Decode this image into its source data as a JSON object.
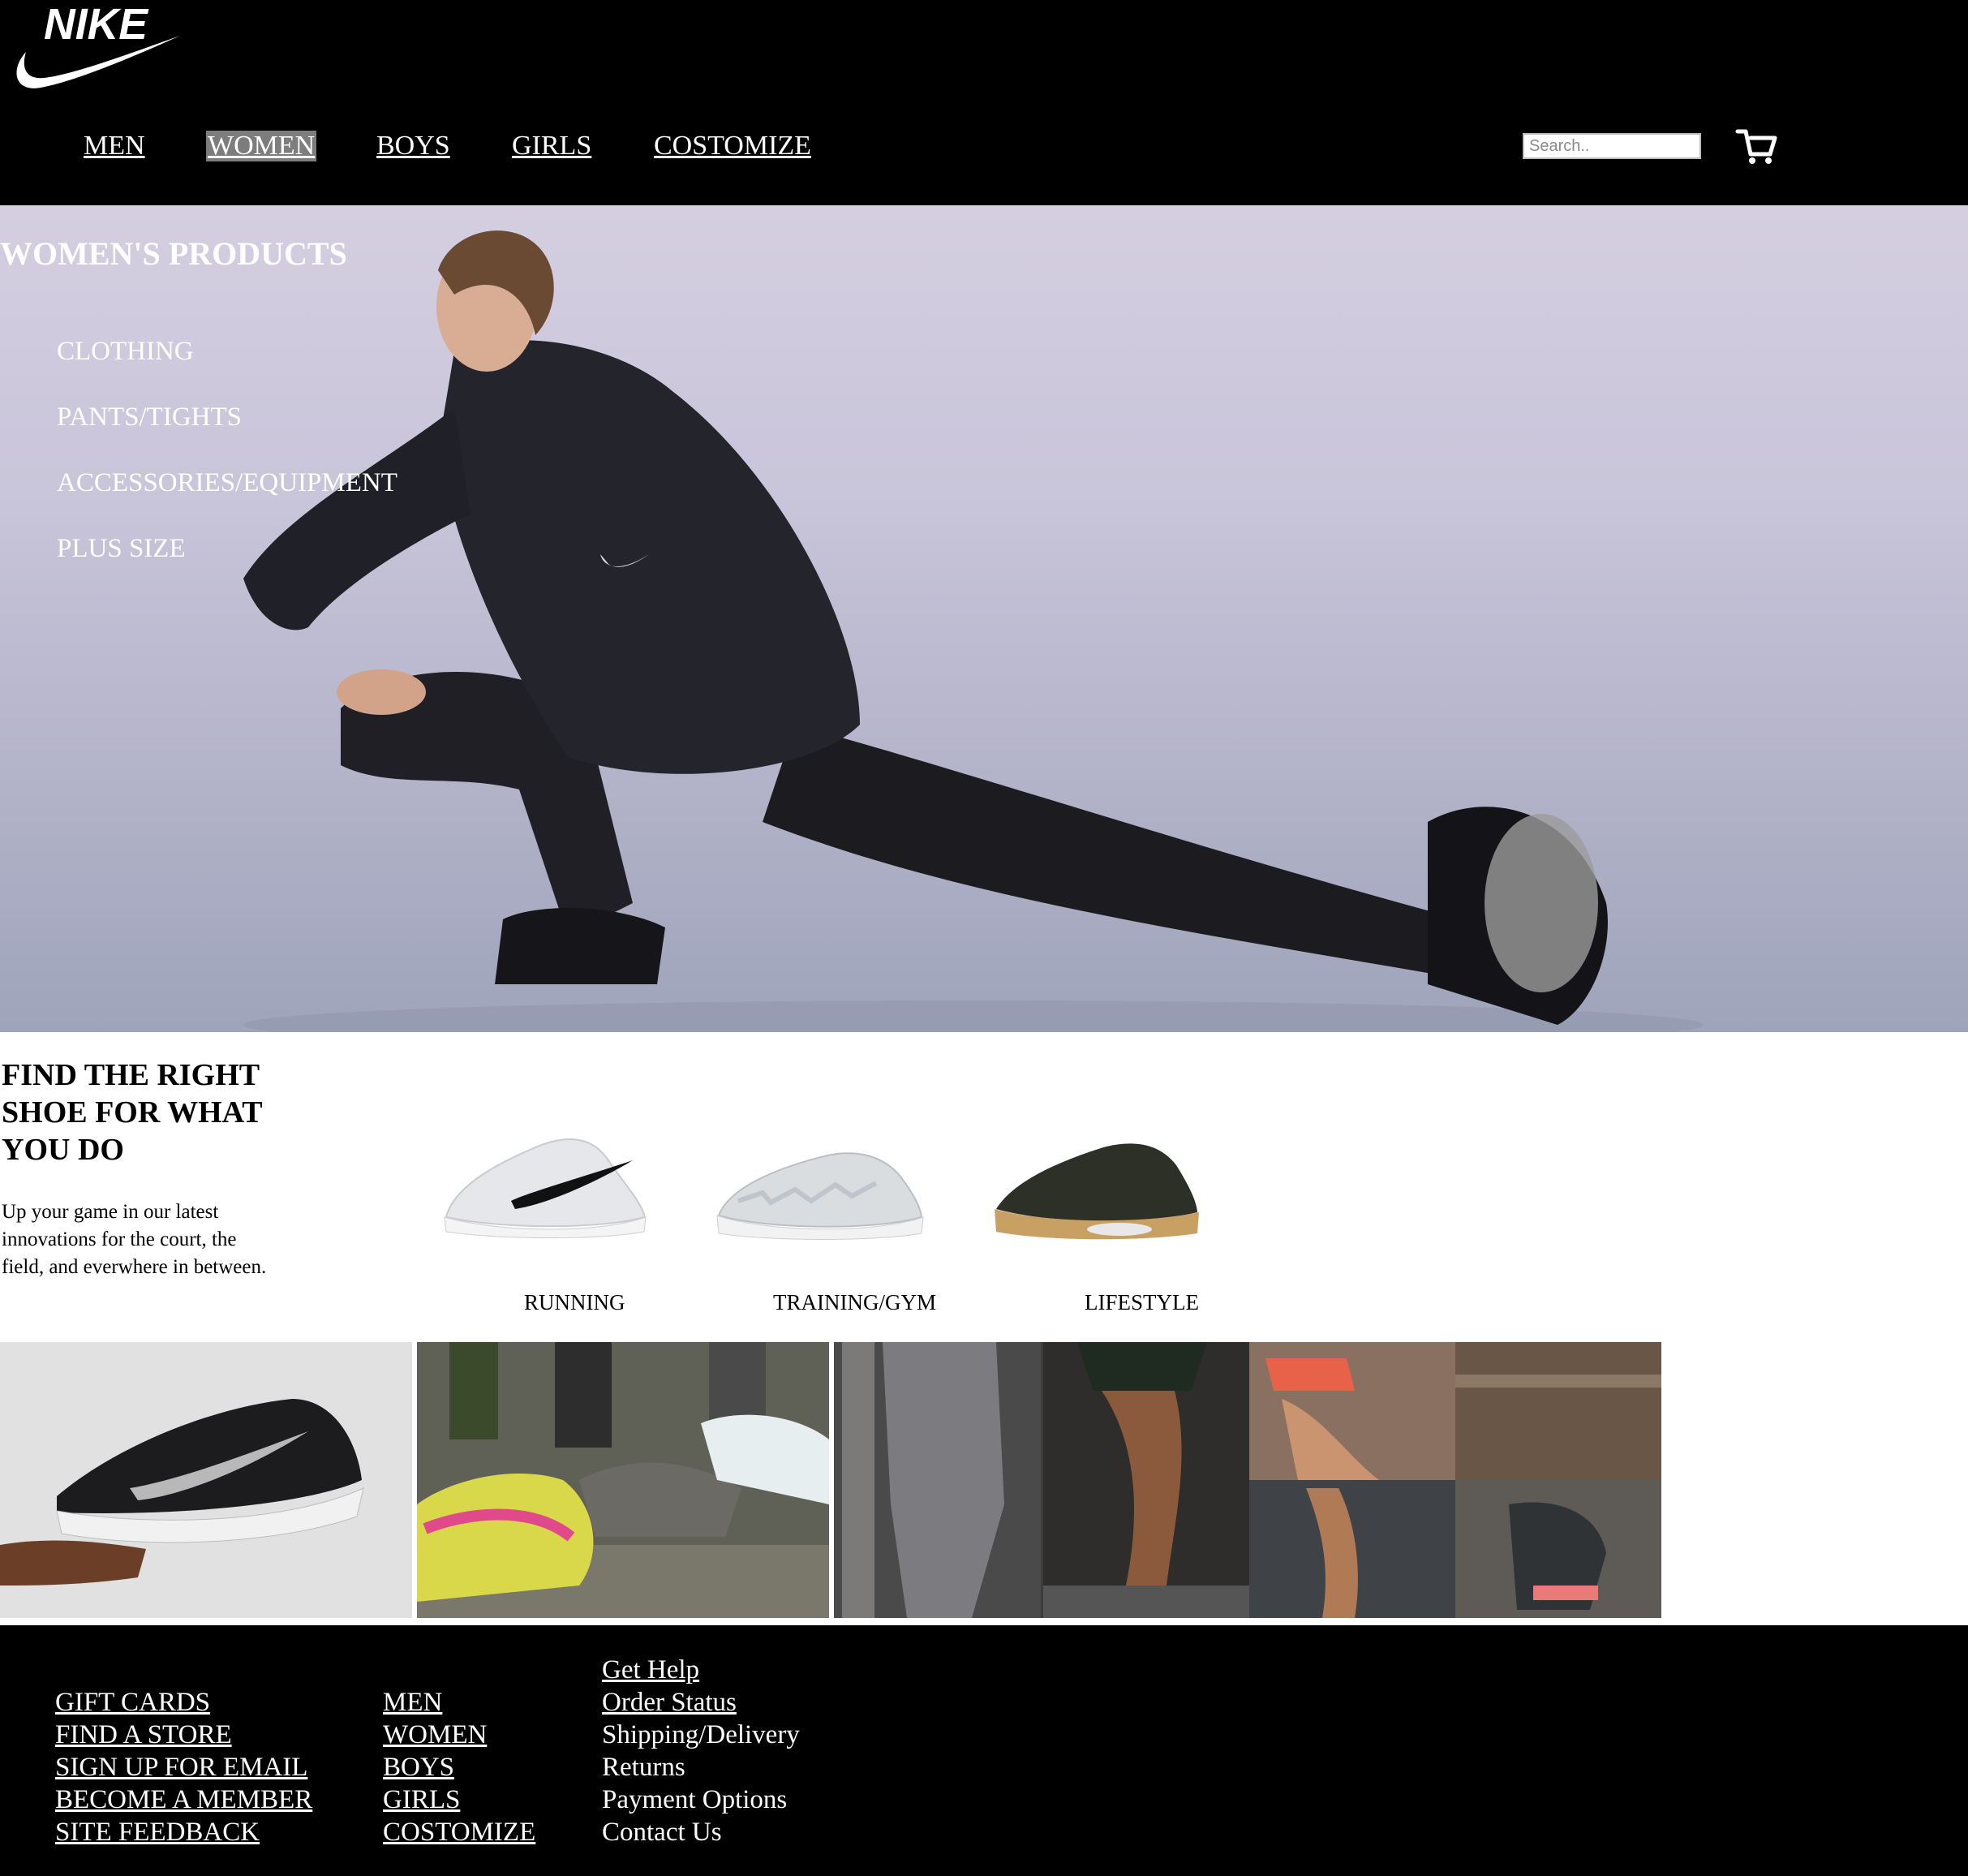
{
  "brand": {
    "name": "NIKE",
    "logo": "nike-swoosh-logo"
  },
  "nav": [
    "MEN",
    "WOMEN",
    "BOYS",
    "GIRLS",
    "COSTOMIZE"
  ],
  "nav_active": "WOMEN",
  "search": {
    "placeholder": "Search.."
  },
  "cart": {
    "icon": "shopping-cart-icon"
  },
  "hero": {
    "title": "WOMEN'S PRODUCTS",
    "menu": [
      "CLOTHING",
      "PANTS/TIGHTS",
      "ACCESSORIES/EQUIPMENT",
      "PLUS SIZE"
    ]
  },
  "find": {
    "title": "FIND THE RIGHT SHOE FOR WHAT YOU DO",
    "text": "Up your game in our latest innovations for the court, the field, and everwhere in between."
  },
  "categories": [
    "RUNNING",
    "TRAINING/GYM",
    "LIFESTYLE"
  ],
  "footer": {
    "col1": [
      "GIFT CARDS",
      "FIND A STORE",
      "SIGN UP FOR EMAIL",
      "BECOME A MEMBER",
      "SITE FEEDBACK"
    ],
    "col2": [
      "MEN",
      "WOMEN",
      "BOYS",
      "GIRLS",
      "COSTOMIZE"
    ],
    "help": {
      "title": "Get Help",
      "order_status": "Order Status",
      "items": [
        "Shipping/Delivery",
        "Returns",
        "Payment Options",
        "Contact Us"
      ]
    }
  },
  "colors": {
    "header_bg": "#000000",
    "footer_bg": "#000000",
    "active_nav_bg": "#7d7d7d",
    "text_light": "#ffffff"
  }
}
